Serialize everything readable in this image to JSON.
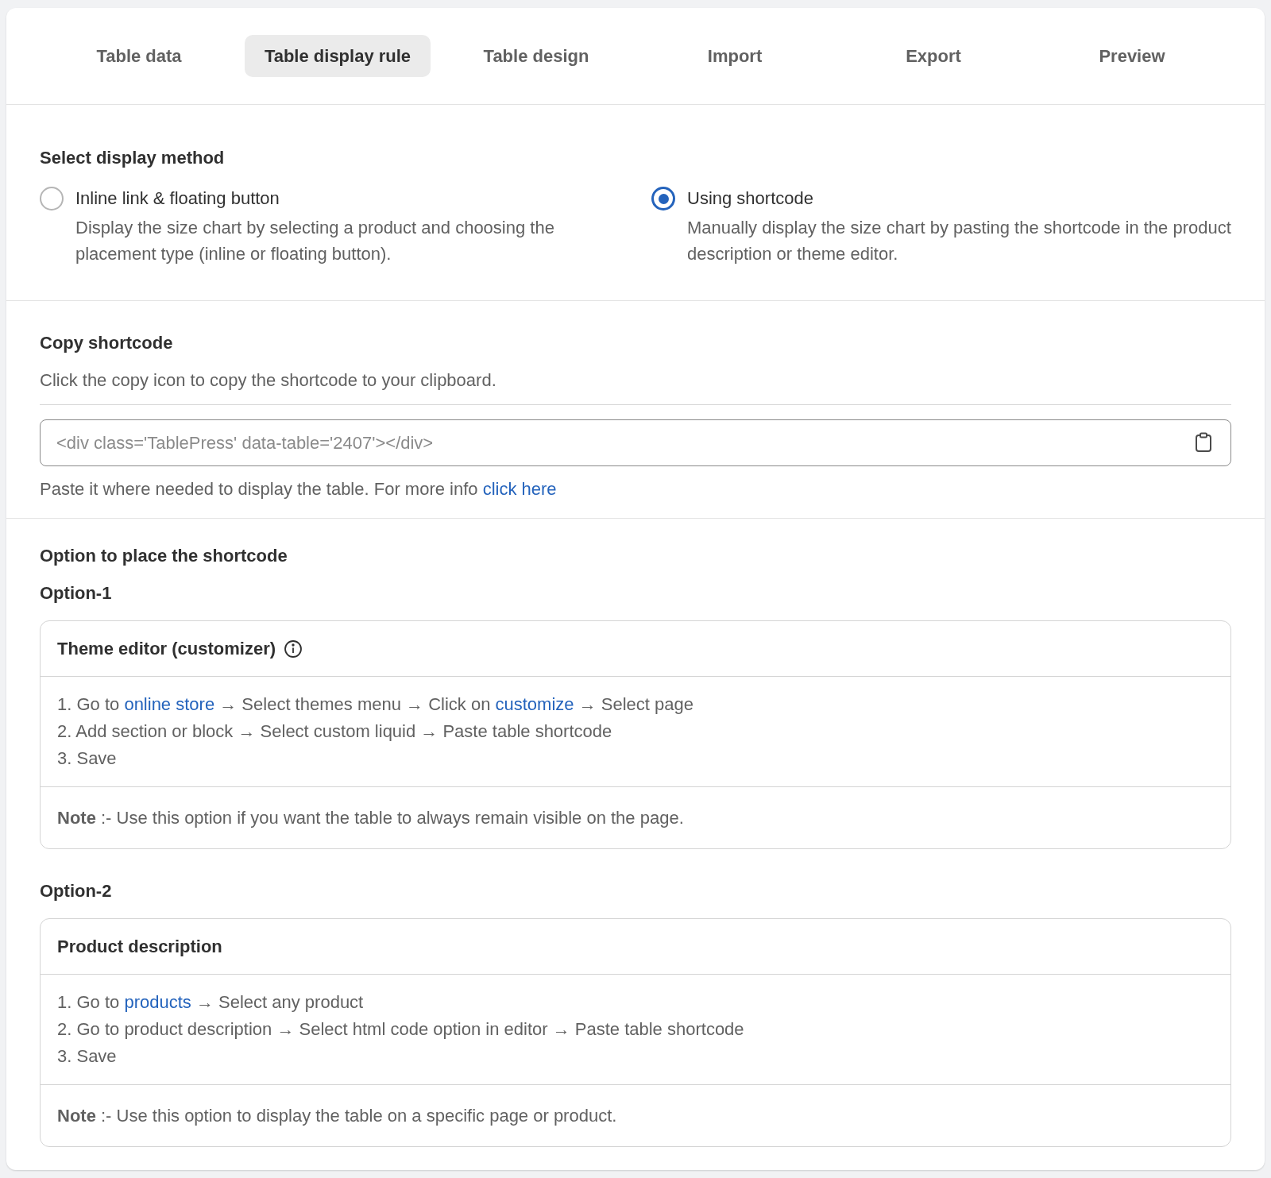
{
  "tabs": [
    {
      "label": "Table data",
      "selected": false
    },
    {
      "label": "Table display rule",
      "selected": true
    },
    {
      "label": "Table design",
      "selected": false
    },
    {
      "label": "Import",
      "selected": false
    },
    {
      "label": "Export",
      "selected": false
    },
    {
      "label": "Preview",
      "selected": false
    }
  ],
  "display_method": {
    "title": "Select display method",
    "options": [
      {
        "label": "Inline link & floating button",
        "description": "Display the size chart by selecting a product and choosing the placement type (inline or floating button).",
        "selected": false
      },
      {
        "label": "Using shortcode",
        "description": "Manually display the size chart by pasting the shortcode in the product description or theme editor.",
        "selected": true
      }
    ]
  },
  "copy_shortcode": {
    "title": "Copy shortcode",
    "subtitle": "Click the copy icon to copy the shortcode to your clipboard.",
    "value": "<div class='TablePress' data-table='2407'></div>",
    "help": [
      {
        "text": "Paste it where needed to display the table. For more info "
      },
      {
        "link": "click here"
      }
    ]
  },
  "placement": {
    "title": "Option to place the shortcode",
    "options": [
      {
        "label": "Option-1",
        "card_title": "Theme editor (customizer)",
        "info_icon": true,
        "steps": [
          [
            {
              "text": "1. Go to "
            },
            {
              "link": "online store"
            },
            {
              "text": " → Select themes menu → Click on "
            },
            {
              "link": "customize"
            },
            {
              "text": " → Select page"
            }
          ],
          [
            {
              "text": "2. Add section or block → Select custom liquid → Paste table shortcode"
            }
          ],
          [
            {
              "text": "3. Save"
            }
          ]
        ],
        "note": "**Note** :- Use this option if you want the table to always remain visible on the page."
      },
      {
        "label": "Option-2",
        "card_title": "Product description",
        "info_icon": false,
        "steps": [
          [
            {
              "text": "1. Go to "
            },
            {
              "link": "products"
            },
            {
              "text": " → Select any product"
            }
          ],
          [
            {
              "text": "2. Go to product description → Select html code option in editor → Paste table shortcode"
            }
          ],
          [
            {
              "text": "3. Save"
            }
          ]
        ],
        "note": "**Note** :- Use this option to display the table on a specific page or product."
      }
    ]
  }
}
